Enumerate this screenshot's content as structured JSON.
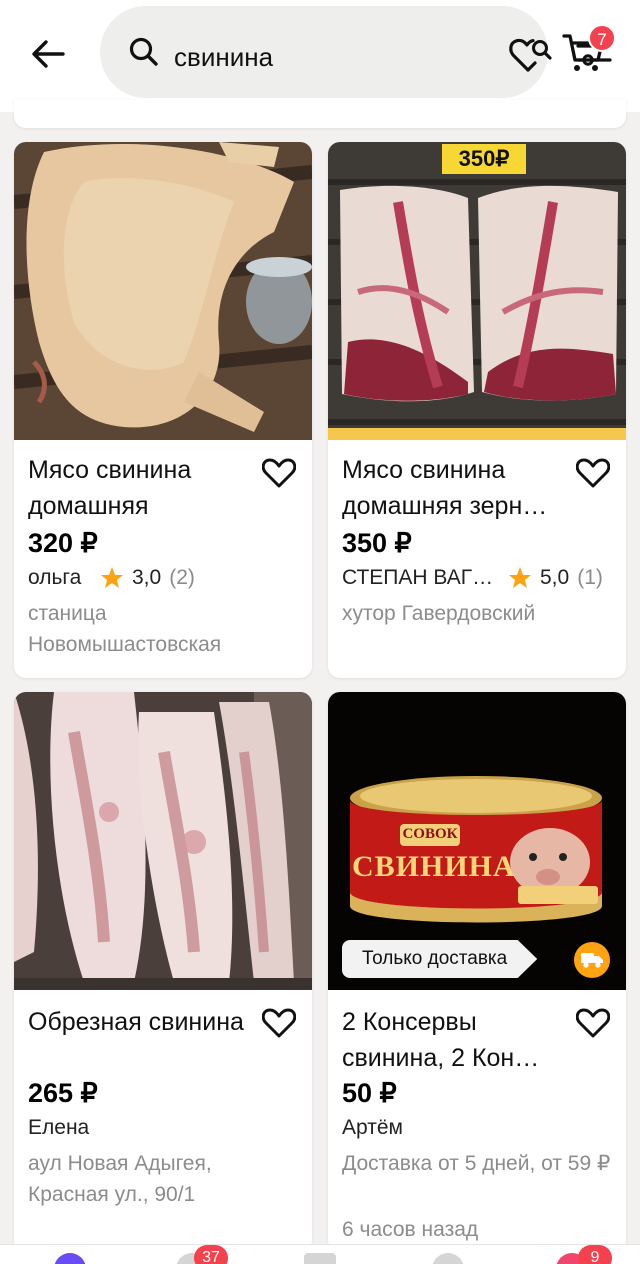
{
  "search": {
    "query": "свинина"
  },
  "cart": {
    "badge_count": "7"
  },
  "colors": {
    "accent_red": "#f4414e",
    "star": "#ffa313",
    "muted_text": "#8c8c8c"
  },
  "listings": [
    {
      "title": "Мясо свинина домашняя",
      "price": "320 ₽",
      "seller": "ольга",
      "rating": "3,0",
      "reviews": "(2)",
      "location": "станица Новомышастовская"
    },
    {
      "title": "Мясо свинина домашняя зерн…",
      "price": "350 ₽",
      "seller": "СТЕПАН ВАГ…",
      "rating": "5,0",
      "reviews": "(1)",
      "location": "хутор Гавердовский",
      "photo_label": "350₽"
    },
    {
      "title": "Обрезная свинина",
      "price": "265 ₽",
      "seller": "Елена",
      "location": "аул Новая Адыгея, Красная ул., 90/1"
    },
    {
      "title": "2 Консервы свинина, 2 Кон…",
      "price": "50 ₽",
      "seller": "Артём",
      "location": "Доставка от 5 дней, от 59 ₽",
      "time": "6 часов назад",
      "delivery_tag": "Только доставка",
      "photo_brand": "СОВОК",
      "photo_product": "СВИНИНА"
    }
  ],
  "bottom_nav": {
    "badge_messages": "37",
    "badge_profile": "9"
  }
}
